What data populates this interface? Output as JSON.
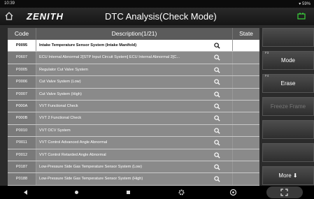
{
  "status": {
    "time": "10:39",
    "battery": "59%"
  },
  "header": {
    "logo": "ZENITH",
    "title": "DTC Analysis(Check Mode)"
  },
  "table": {
    "headers": {
      "code": "Code",
      "description": "Description(1/21)",
      "state": "State"
    },
    "rows": [
      {
        "code": "P0095",
        "description": "Intake Temperature Sensor System (Intake Manifold)",
        "selected": true
      },
      {
        "code": "P0607",
        "description": "ECU Internal Abnormal 2[STP Input Circuit System] ECU Internal Abnormal 2[C..."
      },
      {
        "code": "P0005",
        "description": "Regulator Cut Valve System"
      },
      {
        "code": "P0006",
        "description": "Cut Valve System (Low)"
      },
      {
        "code": "P0007",
        "description": "Cut Valve System (High)"
      },
      {
        "code": "P000A",
        "description": "VVT Functional Check"
      },
      {
        "code": "P000B",
        "description": "VVT 2 Functional Check"
      },
      {
        "code": "P0010",
        "description": "VVT OCV System"
      },
      {
        "code": "P0011",
        "description": "VVT Control Advanced Angle Abnormal"
      },
      {
        "code": "P0012",
        "description": "VVT Control Retarded Angle Abnormal"
      },
      {
        "code": "P0187",
        "description": "Low-Pressure Side Gas Temperature Sensor System (Low)"
      },
      {
        "code": "P0188",
        "description": "Low-Pressure Side Gas Temperature Sensor System (High)"
      }
    ]
  },
  "side": {
    "mode": "Mode",
    "mode_key": "F3",
    "erase": "Erase",
    "erase_key": "F4",
    "freeze": "Freeze Frame",
    "more": "More ⬇"
  }
}
